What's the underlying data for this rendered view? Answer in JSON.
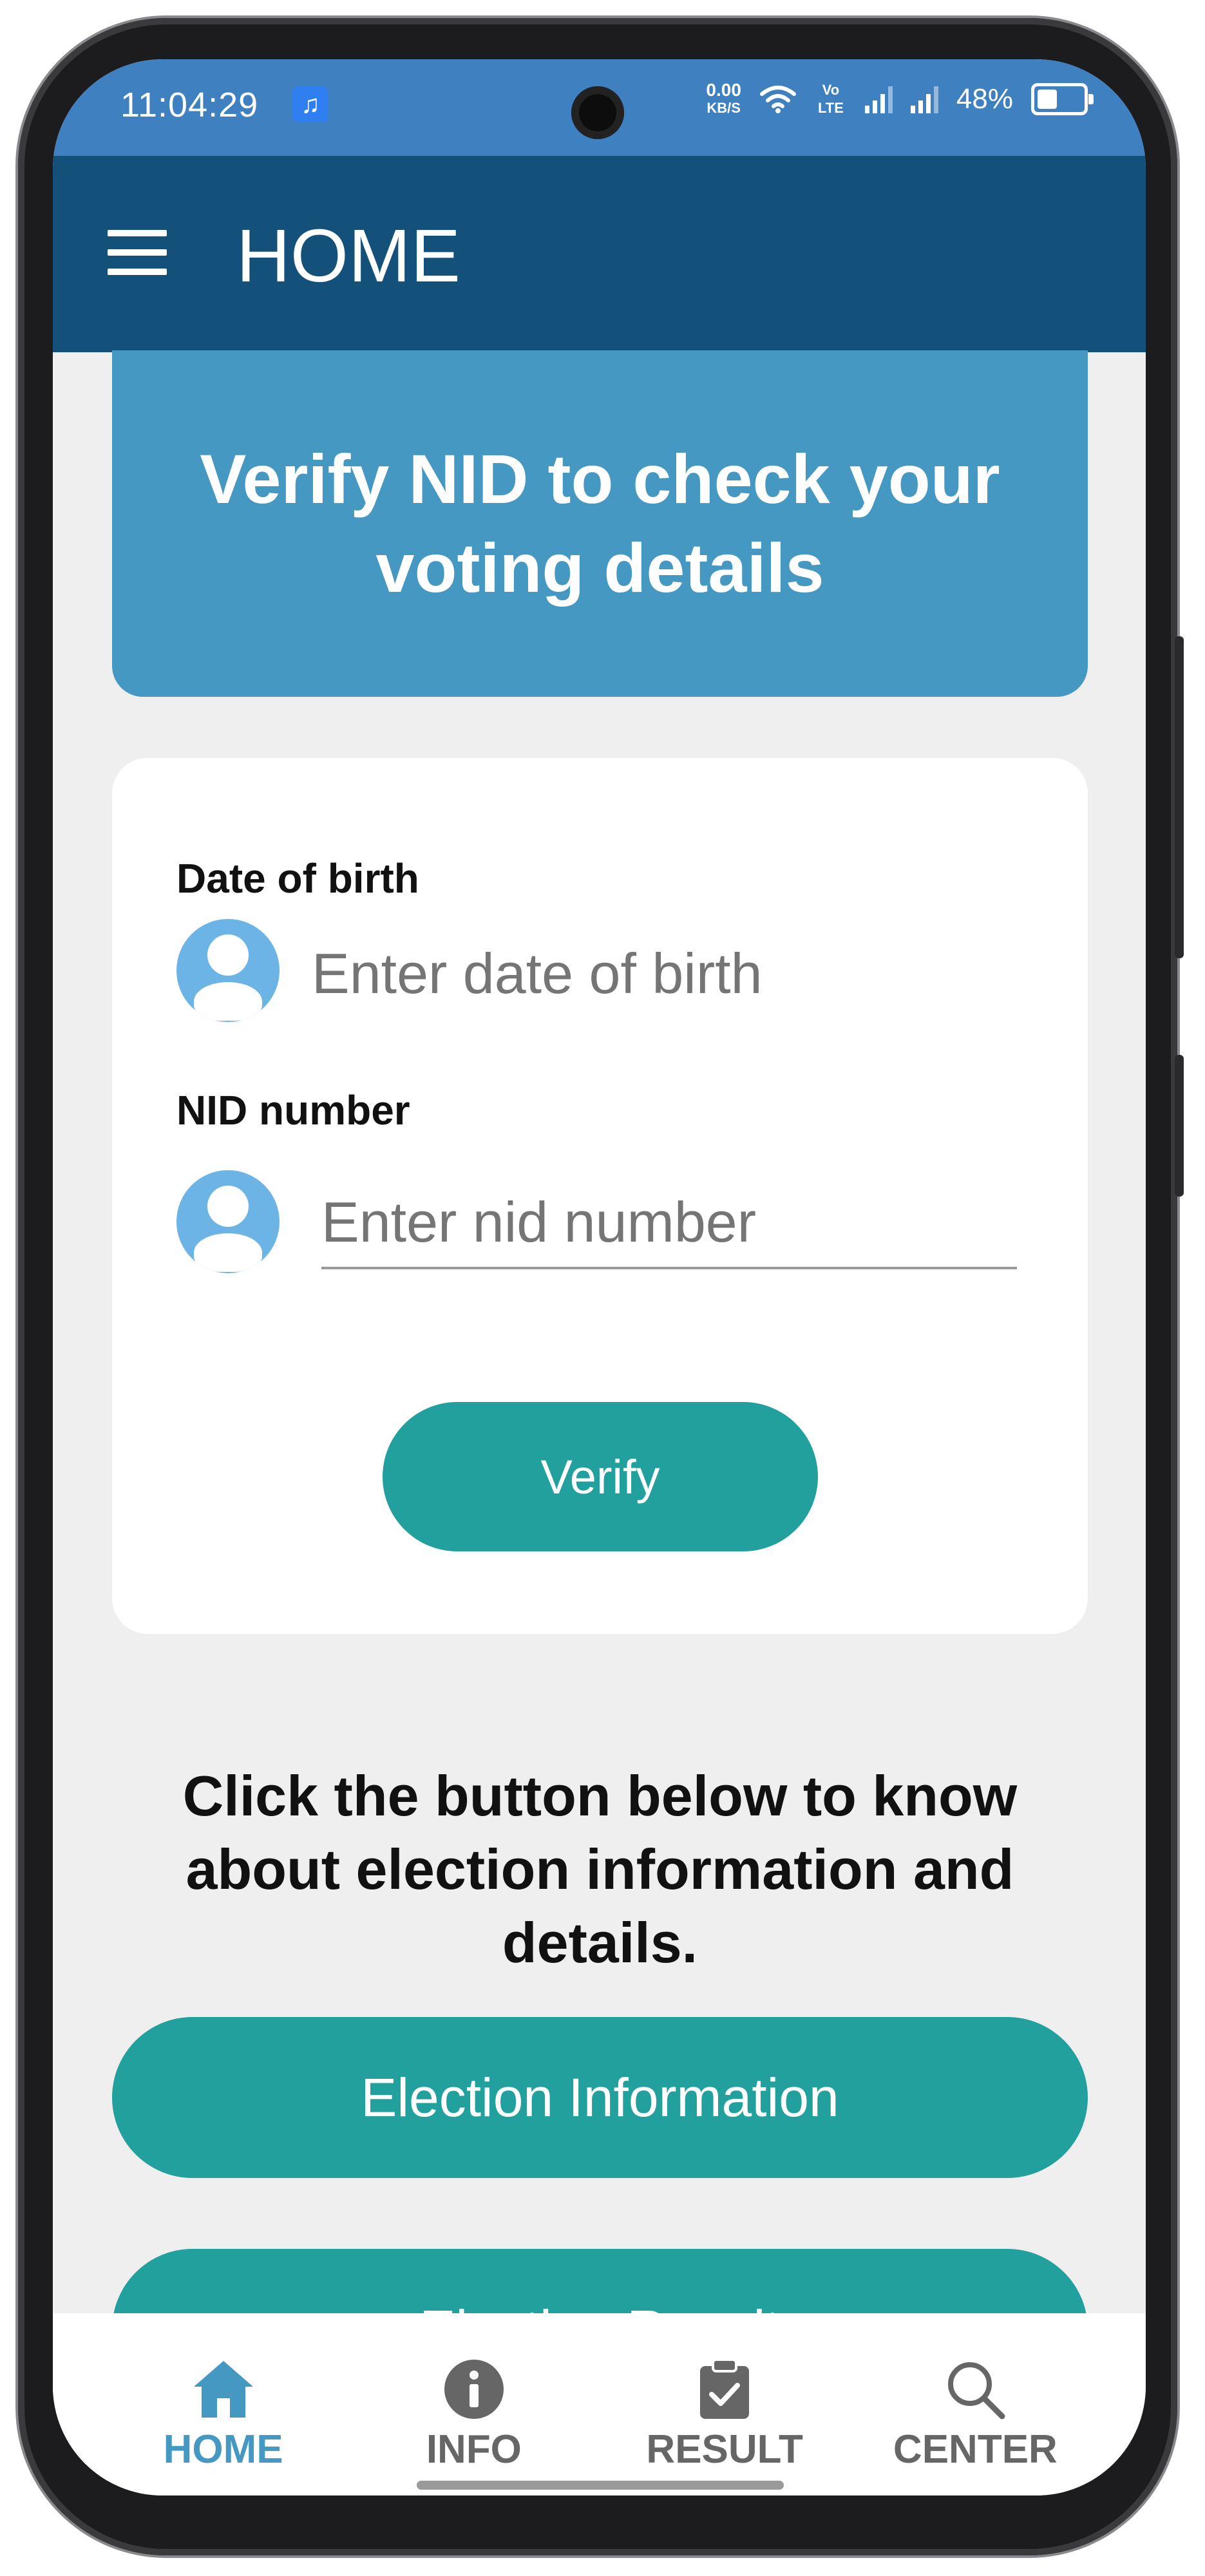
{
  "status_bar": {
    "time": "11:04:29",
    "net_speed_value": "0.00",
    "net_speed_unit": "KB/S",
    "volte": "Vo LTE",
    "battery": "48%"
  },
  "app_bar": {
    "title": "HOME"
  },
  "banner": {
    "text": "Verify NID to check your voting details"
  },
  "form": {
    "dob_label": "Date of birth",
    "dob_placeholder": "Enter date of birth",
    "nid_label": "NID number",
    "nid_placeholder": "Enter nid number",
    "verify_label": "Verify"
  },
  "info_text": "Click the button below to know about election information and details.",
  "buttons": {
    "election_information": "Election Information",
    "election_result": "Election Result"
  },
  "bottom_nav": {
    "items": [
      {
        "label": "HOME",
        "icon": "home-icon",
        "active": true
      },
      {
        "label": "INFO",
        "icon": "info-icon",
        "active": false
      },
      {
        "label": "RESULT",
        "icon": "clipboard-check-icon",
        "active": false
      },
      {
        "label": "CENTER",
        "icon": "search-icon",
        "active": false
      }
    ]
  },
  "colors": {
    "status_bar": "#3f80c0",
    "app_bar": "#13507a",
    "banner": "#4598c1",
    "button": "#22a09e",
    "placeholder": "#63a8b8",
    "avatar": "#6cb3e6",
    "active_nav": "#4598c1"
  }
}
